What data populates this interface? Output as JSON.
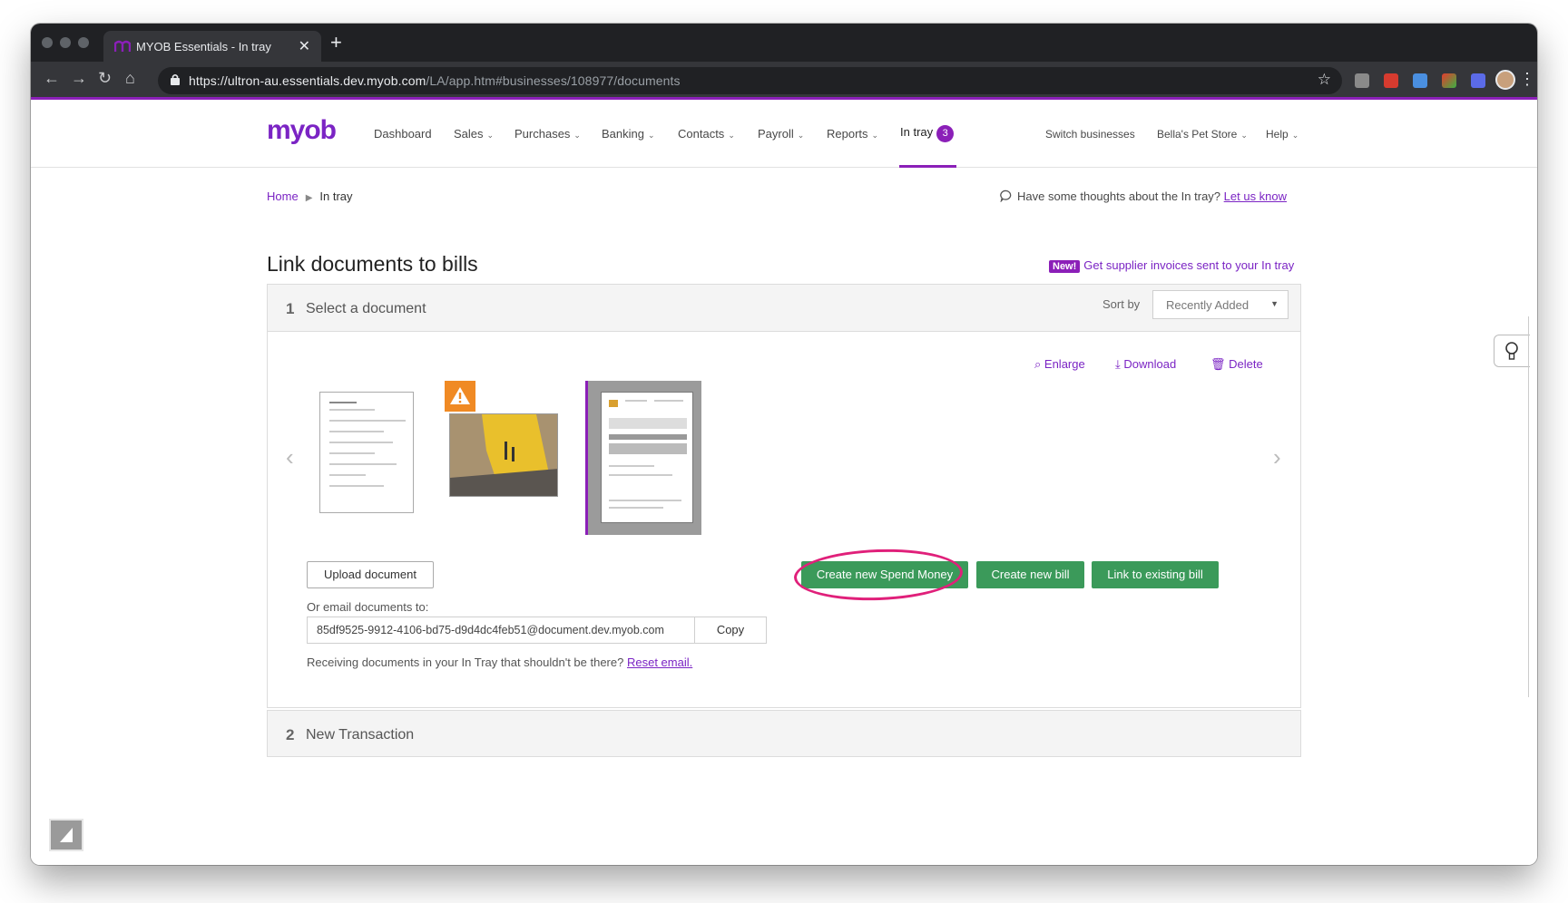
{
  "browser": {
    "tab_title": "MYOB Essentials - In tray",
    "tab_close": "✕",
    "new_tab": "+",
    "url_host": "https://ultron-au.essentials.dev.myob.com",
    "url_path": "/LA/app.htm#businesses/108977/documents"
  },
  "app": {
    "logo": "myob",
    "nav": {
      "dashboard": "Dashboard",
      "sales": "Sales",
      "purchases": "Purchases",
      "banking": "Banking",
      "contacts": "Contacts",
      "payroll": "Payroll",
      "reports": "Reports",
      "intray": "In tray",
      "intray_count": "3"
    },
    "right_nav": {
      "switch": "Switch businesses",
      "business": "Bella's Pet Store",
      "help": "Help"
    }
  },
  "breadcrumb": {
    "home": "Home",
    "current": "In tray"
  },
  "feedback": {
    "text": "Have some thoughts about the In tray?",
    "link": "Let us know"
  },
  "page": {
    "title": "Link documents to bills",
    "new_badge": "New!",
    "new_link": "Get supplier invoices sent to your In tray"
  },
  "step1": {
    "number": "1",
    "title": "Select a document",
    "sort_label": "Sort by",
    "sort_value": "Recently Added",
    "actions": {
      "enlarge": "Enlarge",
      "download": "Download",
      "delete": "Delete"
    },
    "buttons": {
      "upload": "Upload document",
      "spend_money": "Create new Spend Money",
      "new_bill": "Create new bill",
      "link_bill": "Link to existing bill"
    },
    "email_label": "Or email documents to:",
    "email_value": "85df9525-9912-4106-bd75-d9d4dc4feb51@document.dev.myob.com",
    "copy": "Copy",
    "reset_text": "Receiving documents in your In Tray that shouldn't be there?",
    "reset_link": "Reset email."
  },
  "step2": {
    "number": "2",
    "title": "New Transaction"
  },
  "colors": {
    "brand": "#8b1fb8",
    "green": "#3b9a5a",
    "annotation": "#e0207a"
  }
}
